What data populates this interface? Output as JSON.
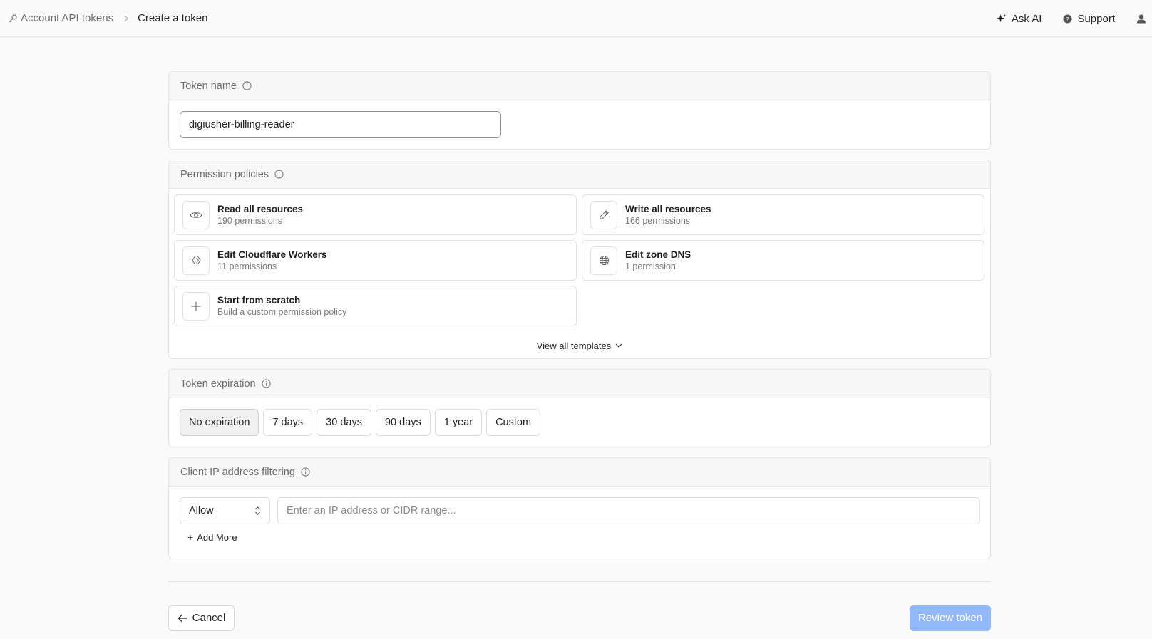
{
  "breadcrumb": {
    "parent": "Account API tokens",
    "current": "Create a token"
  },
  "top_actions": {
    "ask_ai": "Ask AI",
    "support": "Support"
  },
  "token_name": {
    "heading": "Token name",
    "value": "digiusher-billing-reader"
  },
  "permission_policies": {
    "heading": "Permission policies",
    "tiles": [
      {
        "title": "Read all resources",
        "subtitle": "190 permissions",
        "icon": "eye-icon"
      },
      {
        "title": "Write all resources",
        "subtitle": "166 permissions",
        "icon": "pencil-icon"
      },
      {
        "title": "Edit Cloudflare Workers",
        "subtitle": "11 permissions",
        "icon": "workers-icon"
      },
      {
        "title": "Edit zone DNS",
        "subtitle": "1 permission",
        "icon": "globe-icon"
      },
      {
        "title": "Start from scratch",
        "subtitle": "Build a custom permission policy",
        "icon": "plus-icon"
      }
    ],
    "view_all": "View all templates"
  },
  "token_expiration": {
    "heading": "Token expiration",
    "options": [
      "No expiration",
      "7 days",
      "30 days",
      "90 days",
      "1 year",
      "Custom"
    ],
    "selected": "No expiration"
  },
  "ip_filter": {
    "heading": "Client IP address filtering",
    "mode": "Allow",
    "placeholder": "Enter an IP address or CIDR range...",
    "value": "",
    "add_more": "Add More"
  },
  "footer": {
    "cancel": "Cancel",
    "review": "Review token"
  },
  "colors": {
    "primary_disabled": "#93b8f7",
    "border": "#e3e3e3",
    "background": "#fafafa"
  }
}
